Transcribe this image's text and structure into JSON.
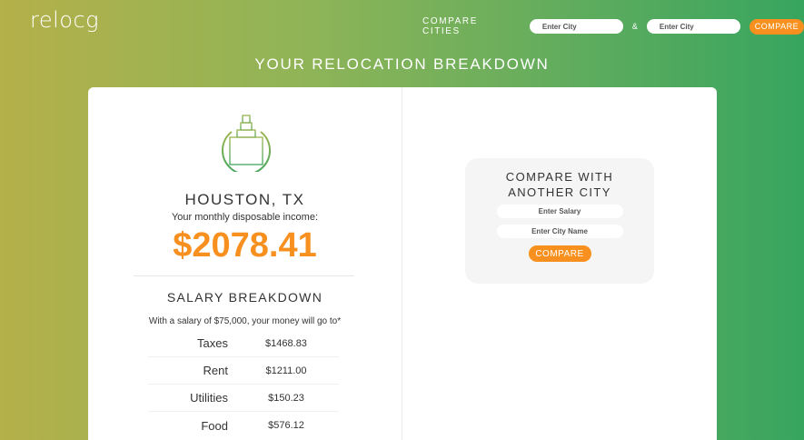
{
  "header": {
    "logo": "relocg",
    "compare_label": "COMPARE CITIES",
    "city1_placeholder": "Enter City",
    "amp": "&",
    "city2_placeholder": "Enter City",
    "compare_button": "COMPARE"
  },
  "page_title": "YOUR RELOCATION BREAKDOWN",
  "summary": {
    "icon": "city-hall-icon",
    "city": "HOUSTON, TX",
    "income_label": "Your monthly disposable income:",
    "income_value": "$2078.41"
  },
  "breakdown": {
    "title": "SALARY BREAKDOWN",
    "note": "With a salary of $75,000, your money will go to*",
    "rows": [
      {
        "label": "Taxes",
        "value": "$1468.83"
      },
      {
        "label": "Rent",
        "value": "$1211.00"
      },
      {
        "label": "Utilities",
        "value": "$150.23"
      },
      {
        "label": "Food",
        "value": "$576.12"
      }
    ]
  },
  "compare_box": {
    "title_line1": "COMPARE WITH",
    "title_line2": "ANOTHER CITY",
    "salary_placeholder": "Enter Salary",
    "city_placeholder": "Enter City Name",
    "button": "COMPARE"
  },
  "colors": {
    "accent": "#f7901e",
    "gradient_start": "#b4b04a",
    "gradient_end": "#37a55f"
  }
}
